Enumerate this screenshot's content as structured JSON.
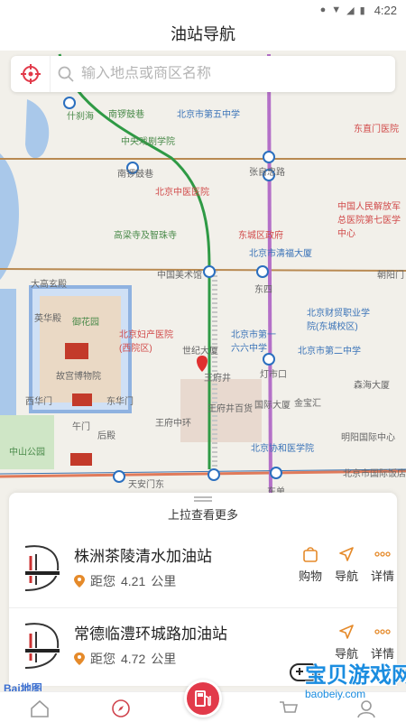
{
  "status_bar": {
    "time": "4:22"
  },
  "title": "油站导航",
  "search": {
    "placeholder": "输入地点或商区名称"
  },
  "map_labels": {
    "shichahai": "什刹海",
    "nanluoguxiang": "南锣鼓巷",
    "zhongyang_xiju": "中央戏剧学院",
    "beijing_5th": "北京市第五中学",
    "dongzhimen_hosp": "东直门医院",
    "zhangzizhonglu": "张自忠路",
    "nanluoguxiang_sub": "南锣鼓巷",
    "zhongyi": "北京中医医院",
    "chengqingsi": "高梁寺及智珠寺",
    "dongcheng_gov": "东城区政府",
    "pla_hosp": "中国人民解放军总医院第七医学中心",
    "jinfu": "北京市清福大厦",
    "meishuguan": "中国美术馆",
    "dongsi": "东四",
    "chaoyangmen": "朝阳门",
    "dagaoxuandian": "大高玄殿",
    "yinghuadian": "英华殿",
    "yuhuayuan": "御花园",
    "fuchan": "北京妇产医院(西院区)",
    "bj_first": "北京市第一六六中学",
    "caizheng": "北京财贸职业学院(东城校区)",
    "shijidasha": "世纪大厦",
    "wangfujing": "王府井",
    "dengshikou": "灯市口",
    "bj_second": "北京市第二中学",
    "gugong": "故宫博物院",
    "xihuamen": "西华门",
    "donghuamen": "东华门",
    "wangfujing_baihuo": "王府井百货",
    "guoji_dasha": "国际大厦",
    "jinbaohui": "金宝汇",
    "senhai": "森海大厦",
    "wumen": "午门",
    "wangfu_zhonghuan": "王府中环",
    "houdian": "后殿",
    "xiehe": "北京协和医学院",
    "mingyue": "明阳国际中心",
    "zhongshan": "中山公园",
    "tiananmen_e": "天安门东",
    "dongdan": "东单",
    "bj_guoji": "北京市国际饭店"
  },
  "panel": {
    "pull_more": "上拉查看更多",
    "stations": [
      {
        "name": "株洲茶陵清水加油站",
        "distance_prefix": "距您",
        "distance": "4.21",
        "unit": "公里"
      },
      {
        "name": "常德临澧环城路加油站",
        "distance_prefix": "距您",
        "distance": "4.72",
        "unit": "公里"
      }
    ],
    "actions": {
      "shop": "购物",
      "nav": "导航",
      "detail": "详情"
    }
  },
  "baidu": {
    "text": "Bai",
    "map": "地图"
  },
  "watermark": {
    "text": "宝贝游戏网",
    "url": "baobeiy.com"
  },
  "colors": {
    "accent": "#e23a4a",
    "station_icon": "#e58a2a",
    "brand_blue": "#1b8de0"
  }
}
